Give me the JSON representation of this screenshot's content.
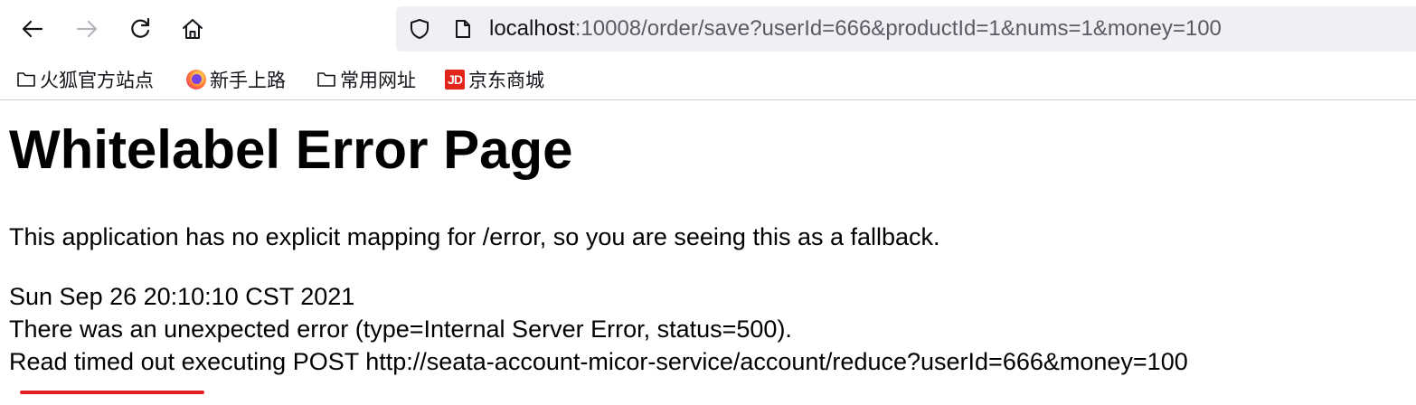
{
  "browser": {
    "url_host": "localhost",
    "url_rest": ":10008/order/save?userId=666&productId=1&nums=1&money=100",
    "icons": {
      "back": "arrow-left-icon",
      "forward": "arrow-right-icon",
      "reload": "reload-icon",
      "home": "home-icon",
      "shield": "shield-icon",
      "page": "page-icon"
    }
  },
  "bookmarks": [
    {
      "label": "火狐官方站点",
      "icon": "folder-icon"
    },
    {
      "label": "新手上路",
      "icon": "firefox-icon"
    },
    {
      "label": "常用网址",
      "icon": "folder-icon"
    },
    {
      "label": "京东商城",
      "icon": "jd-icon",
      "icon_text": "JD"
    }
  ],
  "page": {
    "title": "Whitelabel Error Page",
    "description": "This application has no explicit mapping for /error, so you are seeing this as a fallback.",
    "timestamp": "Sun Sep 26 20:10:10 CST 2021",
    "error_line": "There was an unexpected error (type=Internal Server Error, status=500).",
    "detail_line": "Read timed out executing POST http://seata-account-micor-service/account/reduce?userId=666&money=100"
  },
  "colors": {
    "annotation_underline": "#e02020",
    "jd_brand": "#e1251b"
  }
}
